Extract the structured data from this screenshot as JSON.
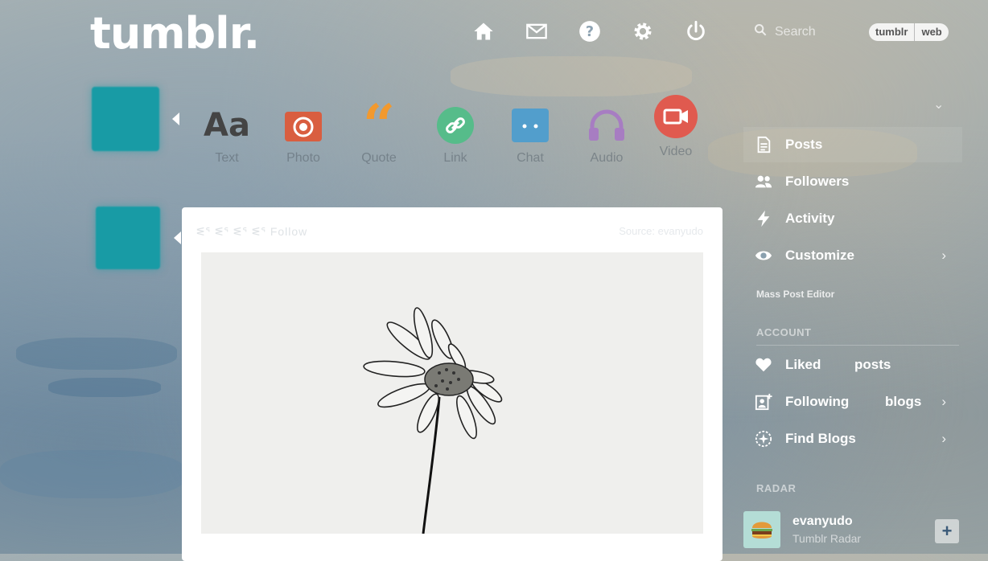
{
  "header": {
    "logo": "tumblr.",
    "search_placeholder": "Search",
    "toggle": [
      "tumblr",
      "web"
    ]
  },
  "post_types": [
    {
      "label": "Text",
      "icon": "text-icon",
      "color": "#444444"
    },
    {
      "label": "Photo",
      "icon": "camera-icon",
      "color": "#d95e40"
    },
    {
      "label": "Quote",
      "icon": "quote-icon",
      "color": "#f2992e"
    },
    {
      "label": "Link",
      "icon": "link-icon",
      "color": "#56bc8a"
    },
    {
      "label": "Chat",
      "icon": "chat-icon",
      "color": "#529ecc"
    },
    {
      "label": "Audio",
      "icon": "headphones-icon",
      "color": "#a77dc2"
    },
    {
      "label": "Video",
      "icon": "video-icon",
      "color": "#e05a4f"
    }
  ],
  "post": {
    "blog_name": "ᓬᕐ ᓬᕐ ᓬᕐ ᓬᕐ Follow",
    "meta": "Source: evanyudo"
  },
  "sidebar": {
    "items": [
      {
        "label": "Posts",
        "icon": "document-icon"
      },
      {
        "label": "Followers",
        "icon": "followers-icon"
      },
      {
        "label": "Activity",
        "icon": "lightning-icon"
      },
      {
        "label": "Customize",
        "icon": "eye-icon"
      }
    ],
    "mass_post_editor": "Mass Post Editor",
    "account_heading": "ACCOUNT",
    "account_items": [
      {
        "label": "Liked",
        "count_label": "posts",
        "icon": "heart-icon"
      },
      {
        "label": "Following",
        "count_label": "blogs",
        "icon": "following-icon"
      },
      {
        "label": "Find Blogs",
        "icon": "compass-icon"
      }
    ],
    "radar_heading": "RADAR",
    "radar": {
      "name": "evanyudo",
      "subtitle": "Tumblr Radar",
      "follow_label": "+"
    }
  },
  "colors": {
    "teal": "#189ba5",
    "white": "#ffffff"
  }
}
